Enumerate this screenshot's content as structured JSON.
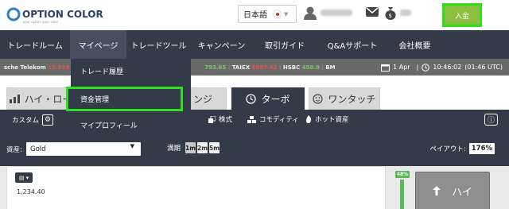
{
  "header": {
    "logo": {
      "brand": "OPTION COLOR",
      "tagline": "your option your color"
    },
    "language": {
      "label": "日本語"
    },
    "deposit_label": "入金",
    "icons": [
      "user-icon",
      "mail-icon",
      "money-bag-icon"
    ]
  },
  "nav": {
    "items": [
      {
        "label": "トレードルーム"
      },
      {
        "label": "マイページ"
      },
      {
        "label": "トレードツール"
      },
      {
        "label": "キャンペーン"
      },
      {
        "label": "取引ガイド"
      },
      {
        "label": "Q&Aサポート"
      },
      {
        "label": "会社概要"
      }
    ]
  },
  "dropdown": {
    "items": [
      {
        "label": "トレード履歴"
      },
      {
        "label": "資金管理"
      },
      {
        "label": "マイプロフィール"
      }
    ]
  },
  "ticker": {
    "items": [
      {
        "name": "sche Telekom",
        "value": "15.919"
      },
      {
        "name": "",
        "value": "793.65"
      },
      {
        "name": "TAIEX",
        "value": "8887.42"
      },
      {
        "name": "HSBC",
        "value": "450.8"
      },
      {
        "name": "BM",
        "value": ""
      }
    ],
    "date": "1 Apr",
    "time": "10:46:02",
    "utc": "(01:46 UTC)"
  },
  "tabs": {
    "high_low": "ハイ・ロー",
    "range": "ンジ",
    "turbo": "ターボ",
    "one_touch": "ワンタッチ"
  },
  "subbar": {
    "custom": "カスタム",
    "stocks": "株式",
    "commodity": "コモディティ",
    "hot": "ホット資産"
  },
  "controls": {
    "asset_label": "資産:",
    "asset_value": "Gold",
    "expiry_label": "満期",
    "expiries": [
      "1m",
      "2m",
      "5m"
    ],
    "payout_label": "ペイアウト:",
    "payout_value": "176%"
  },
  "chart": {
    "price": "1,234.40"
  },
  "trade": {
    "percent": "48%",
    "high_label": "ハイ"
  },
  "colors": {
    "nav_bg": "#333a48",
    "highlight": "#2ee01e",
    "deposit_bg": "#8cbf3f",
    "up": "#5cb85c"
  }
}
